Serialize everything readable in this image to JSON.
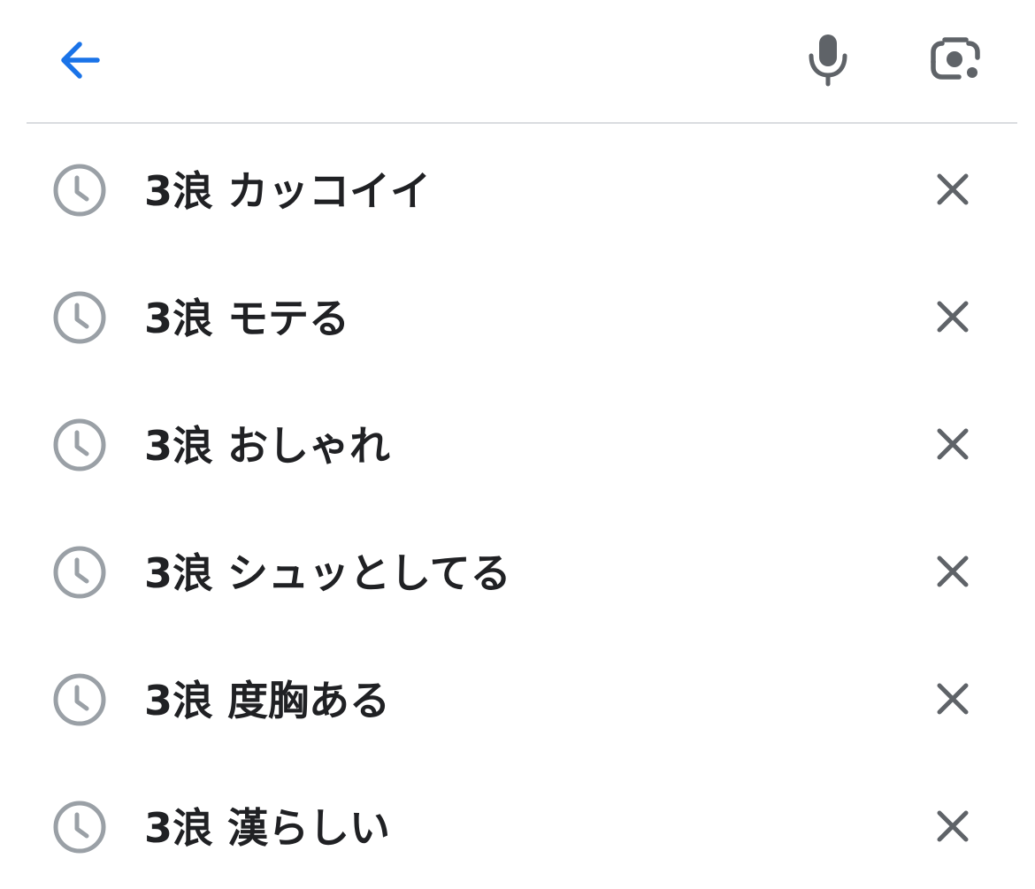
{
  "header": {
    "back_icon": "arrow-left-icon",
    "mic_icon": "microphone-icon",
    "lens_icon": "camera-lens-icon",
    "accent_color": "#1a73e8",
    "icon_color": "#5f6368"
  },
  "history": {
    "history_icon": "clock-icon",
    "remove_icon": "close-icon",
    "items": [
      {
        "label": "3浪 カッコイイ"
      },
      {
        "label": "3浪 モテる"
      },
      {
        "label": "3浪 おしゃれ"
      },
      {
        "label": "3浪 シュッとしてる"
      },
      {
        "label": "3浪 度胸ある"
      },
      {
        "label": "3浪 漢らしい"
      }
    ]
  }
}
